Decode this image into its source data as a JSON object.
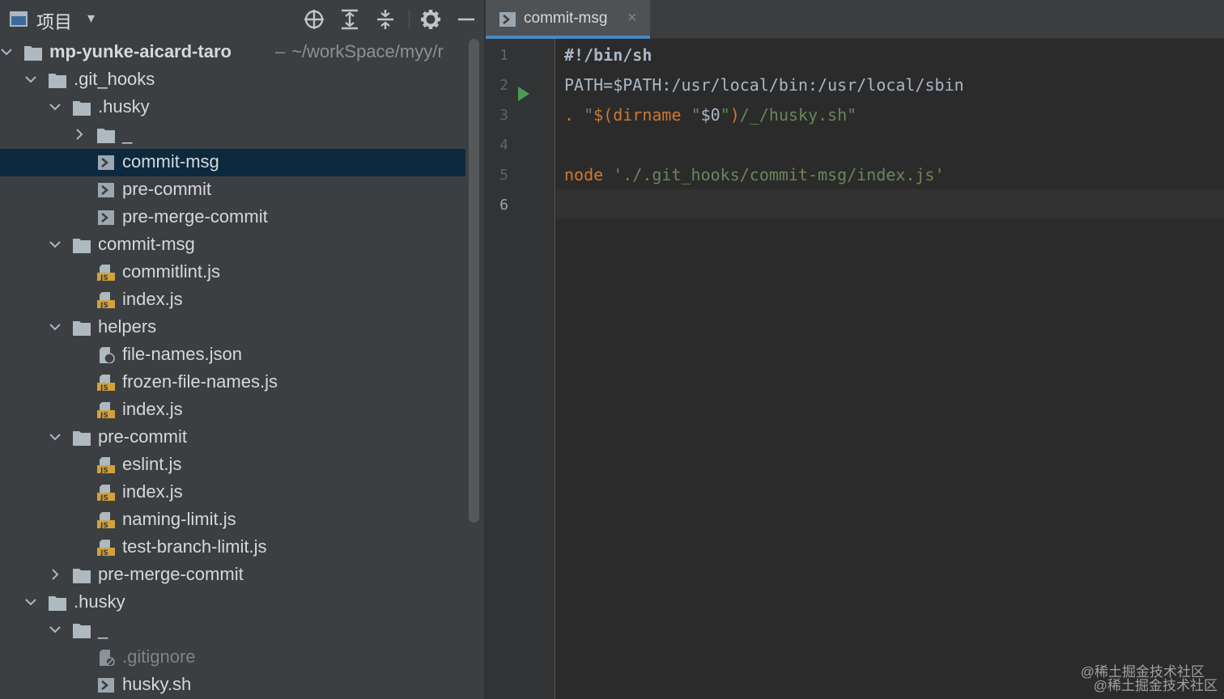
{
  "project_panel": {
    "title": "项目",
    "dropdown_glyph": "▾",
    "toolbar": [
      "locate-icon",
      "expand-all-icon",
      "collapse-all-icon",
      "gear-icon",
      "minimize-icon"
    ]
  },
  "tree": {
    "root_name": "mp-yunke-aicard-taro",
    "root_path": "~/workSpace/myy/r",
    "root_path_sep": "–",
    "items": [
      {
        "label": ".git_hooks",
        "type": "folder",
        "expanded": true
      },
      {
        "label": ".husky",
        "type": "folder",
        "expanded": true
      },
      {
        "label": "_",
        "type": "folder",
        "expanded": false
      },
      {
        "label": "commit-msg",
        "type": "shell",
        "selected": true
      },
      {
        "label": "pre-commit",
        "type": "shell"
      },
      {
        "label": "pre-merge-commit",
        "type": "shell"
      },
      {
        "label": "commit-msg",
        "type": "folder",
        "expanded": true
      },
      {
        "label": "commitlint.js",
        "type": "js"
      },
      {
        "label": "index.js",
        "type": "js"
      },
      {
        "label": "helpers",
        "type": "folder",
        "expanded": true
      },
      {
        "label": "file-names.json",
        "type": "json"
      },
      {
        "label": "frozen-file-names.js",
        "type": "js"
      },
      {
        "label": "index.js",
        "type": "js"
      },
      {
        "label": "pre-commit",
        "type": "folder",
        "expanded": true
      },
      {
        "label": "eslint.js",
        "type": "js"
      },
      {
        "label": "index.js",
        "type": "js"
      },
      {
        "label": "naming-limit.js",
        "type": "js"
      },
      {
        "label": "test-branch-limit.js",
        "type": "js"
      },
      {
        "label": "pre-merge-commit",
        "type": "folder",
        "expanded": false
      },
      {
        "label": ".husky",
        "type": "folder",
        "expanded": true
      },
      {
        "label": "_",
        "type": "folder",
        "expanded": true
      },
      {
        "label": ".gitignore",
        "type": "ignored",
        "dim": true
      },
      {
        "label": "husky.sh",
        "type": "shell"
      }
    ]
  },
  "editor": {
    "tab_label": "commit-msg",
    "tab_close": "×",
    "line_numbers": [
      "1",
      "2",
      "3",
      "4",
      "5",
      "6"
    ],
    "current_line": "6",
    "code": {
      "l1": "#!/bin/sh",
      "l2": "PATH=$PATH:/usr/local/bin:/usr/local/sbin",
      "l3_dot": ". ",
      "l3_open": "\"",
      "l3_sub": "$(dirname ",
      "l3_q": "\"",
      "l3_arg": "$0",
      "l3_q2": "\"",
      "l3_close": ")",
      "l3_rest": "/_/husky.sh\"",
      "l5_cmd": "node",
      "l5_str": " './.git_hooks/commit-msg/index.js'"
    }
  },
  "watermark": {
    "line1": "@稀土掘金技术社区",
    "line2": "@稀土掘金技术社区"
  },
  "colors": {
    "panel_bg": "#3c3f41",
    "editor_bg": "#2b2b2b",
    "selection": "#0d293e",
    "accent": "#4a88c7",
    "keyword": "#cc7832",
    "string": "#6a8759",
    "run_green": "#499c54"
  }
}
